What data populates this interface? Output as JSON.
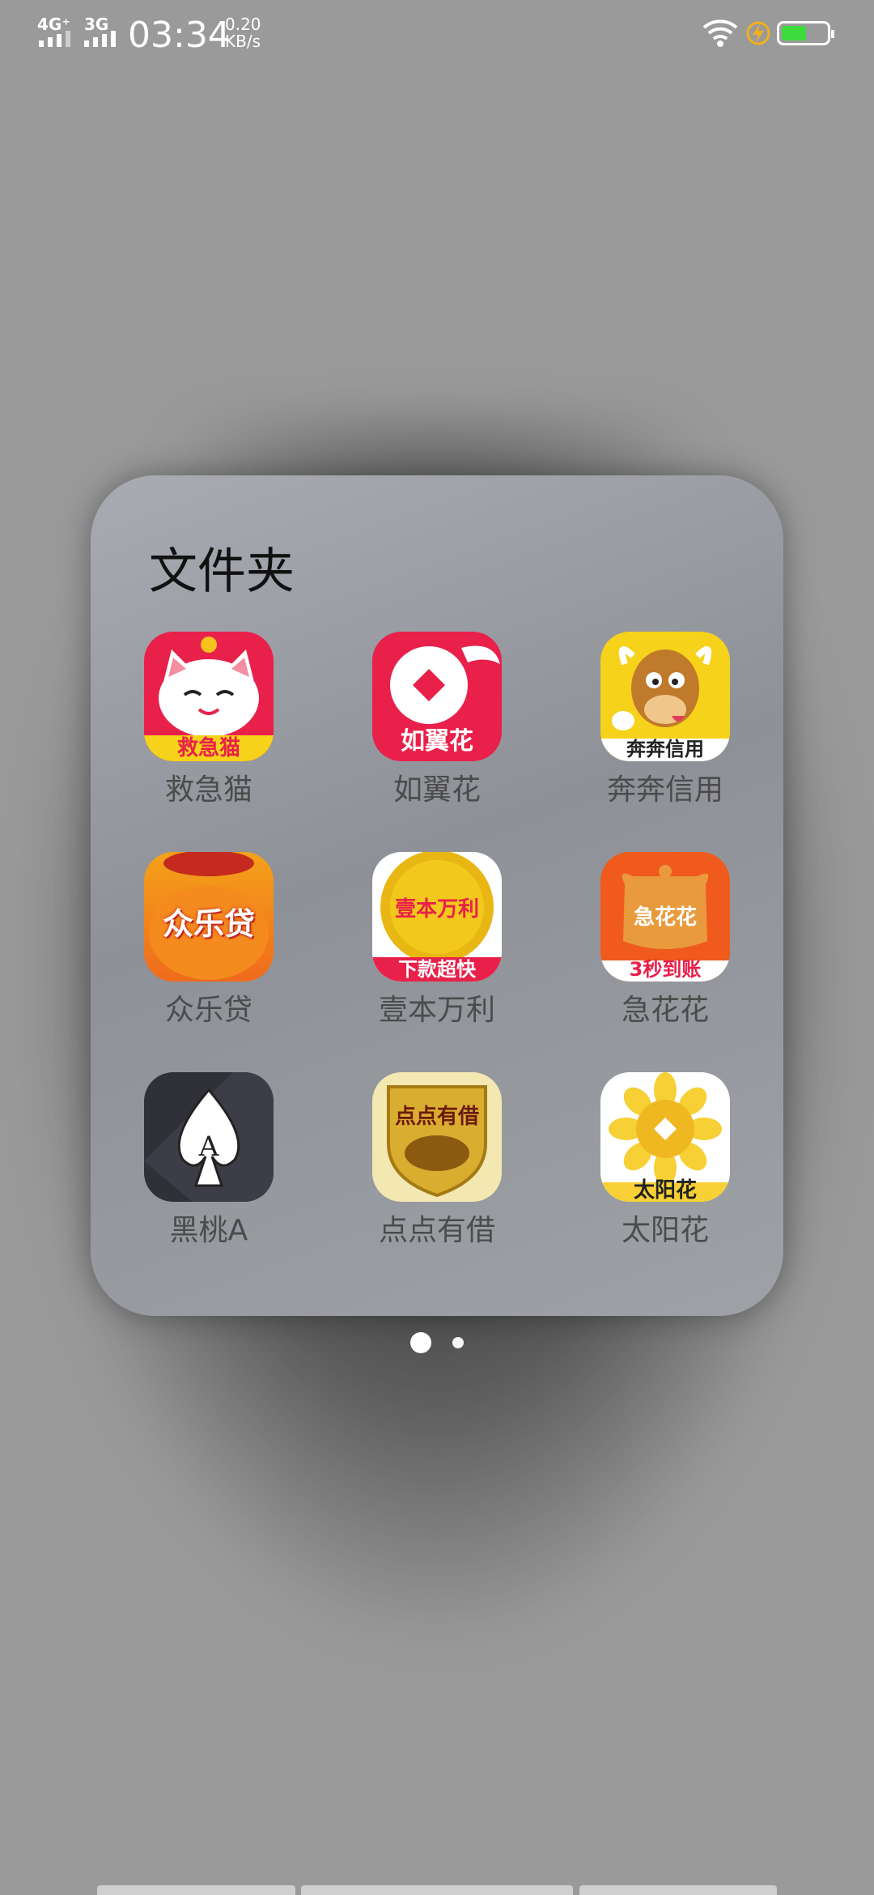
{
  "status_bar": {
    "network1": "4G⁺",
    "network2": "3G",
    "time": "03:34",
    "speed_value": "0.20",
    "speed_unit": "KB/s",
    "battery_level": 0.55,
    "icons": [
      "wifi-icon",
      "charging-icon",
      "battery-icon"
    ]
  },
  "folder": {
    "title": "文件夹",
    "apps": [
      {
        "name": "救急猫",
        "icon_text": "救急猫"
      },
      {
        "name": "如翼花",
        "icon_text": "如翼花"
      },
      {
        "name": "奔奔信用",
        "icon_text": "奔奔信用"
      },
      {
        "name": "众乐贷",
        "icon_text": "众乐贷"
      },
      {
        "name": "壹本万利",
        "icon_text": "壹本万利",
        "icon_subtext": "下款超快"
      },
      {
        "name": "急花花",
        "icon_text": "急花花",
        "icon_subtext": "3秒到账"
      },
      {
        "name": "黑桃A",
        "icon_text": "A"
      },
      {
        "name": "点点有借",
        "icon_text": "点点有借"
      },
      {
        "name": "太阳花",
        "icon_text": "太阳花"
      }
    ],
    "page_count": 2,
    "current_page": 1
  },
  "colors": {
    "background": "#9a9a9b",
    "folder": "#9a9da3",
    "label": "#4b4b4b",
    "battery_green": "#3ddc3d"
  }
}
